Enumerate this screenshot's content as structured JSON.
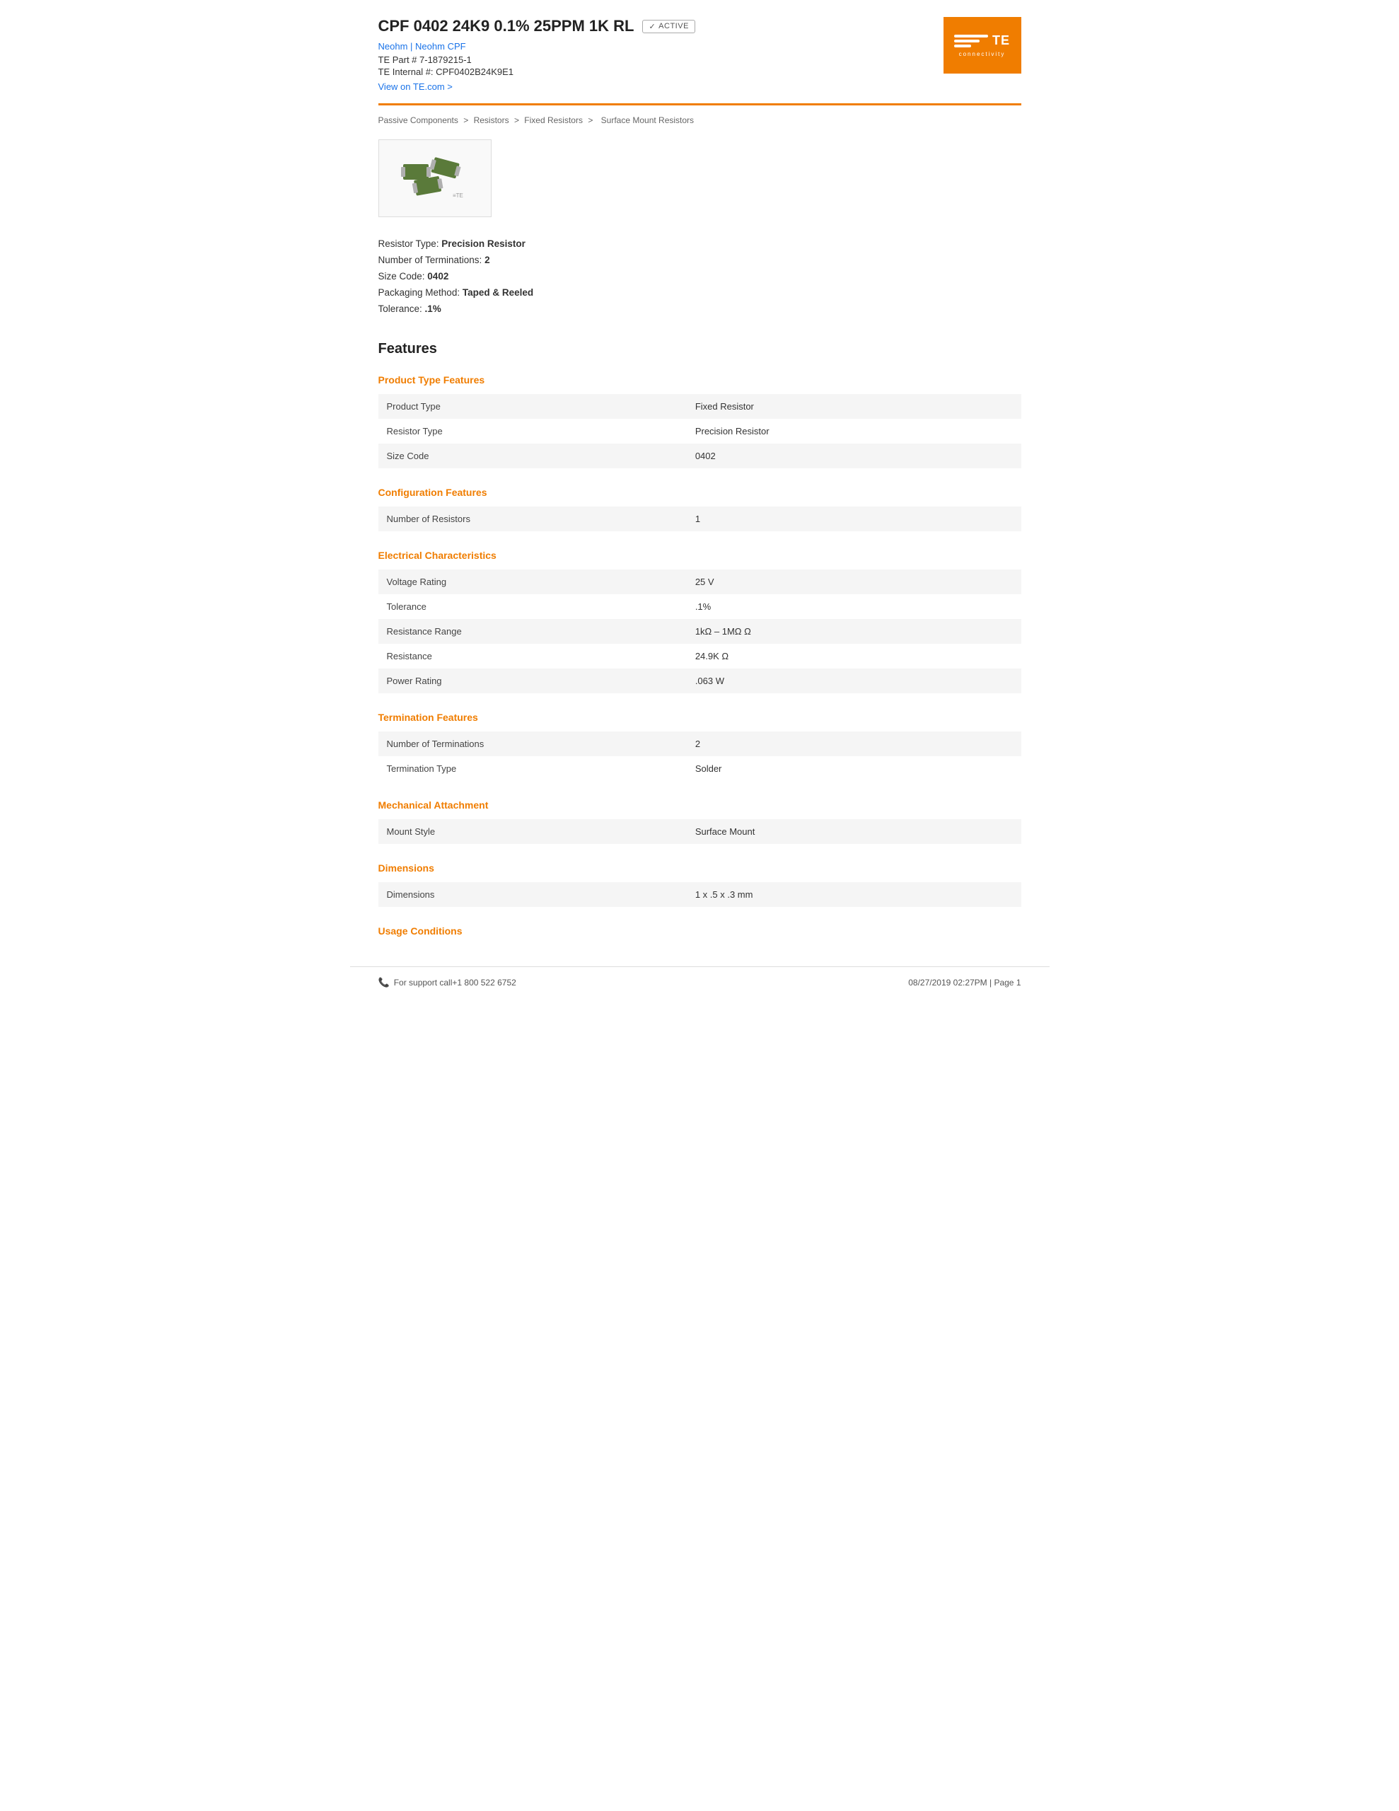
{
  "header": {
    "product_title": "CPF 0402 24K9 0.1% 25PPM 1K RL",
    "active_badge": "ACTIVE",
    "brand": "Neohm | Neohm CPF",
    "brand_link1": "Neohm",
    "brand_link2": "Neohm CPF",
    "te_part": "TE Part # 7-1879215-1",
    "te_internal": "TE Internal #: CPF0402B24K9E1",
    "view_link_text": "View on TE.com >",
    "view_link_href": "#"
  },
  "breadcrumb": {
    "items": [
      "Passive Components",
      "Resistors",
      "Fixed Resistors",
      "Surface Mount Resistors"
    ]
  },
  "quick_specs": [
    {
      "label": "Resistor Type:",
      "value": "Precision Resistor"
    },
    {
      "label": "Number of Terminations:",
      "value": "2"
    },
    {
      "label": "Size Code:",
      "value": "0402"
    },
    {
      "label": "Packaging Method:",
      "value": "Taped & Reeled"
    },
    {
      "label": "Tolerance:",
      "value": ".1%"
    }
  ],
  "features_heading": "Features",
  "sections": [
    {
      "title": "Product Type Features",
      "rows": [
        {
          "label": "Product Type",
          "value": "Fixed Resistor"
        },
        {
          "label": "Resistor Type",
          "value": "Precision Resistor"
        },
        {
          "label": "Size Code",
          "value": "0402"
        }
      ]
    },
    {
      "title": "Configuration Features",
      "rows": [
        {
          "label": "Number of Resistors",
          "value": "1"
        }
      ]
    },
    {
      "title": "Electrical Characteristics",
      "rows": [
        {
          "label": "Voltage Rating",
          "value": "25 V"
        },
        {
          "label": "Tolerance",
          "value": ".1%"
        },
        {
          "label": "Resistance Range",
          "value": "1kΩ – 1MΩ Ω"
        },
        {
          "label": "Resistance",
          "value": "24.9K Ω"
        },
        {
          "label": "Power Rating",
          "value": ".063 W"
        }
      ]
    },
    {
      "title": "Termination Features",
      "rows": [
        {
          "label": "Number of Terminations",
          "value": "2"
        },
        {
          "label": "Termination Type",
          "value": "Solder"
        }
      ]
    },
    {
      "title": "Mechanical Attachment",
      "rows": [
        {
          "label": "Mount Style",
          "value": "Surface Mount"
        }
      ]
    },
    {
      "title": "Dimensions",
      "rows": [
        {
          "label": "Dimensions",
          "value": "1 x .5 x .3 mm"
        }
      ]
    },
    {
      "title": "Usage Conditions",
      "rows": []
    }
  ],
  "footer": {
    "support_text": "For support call+1 800 522 6752",
    "date_page": "08/27/2019 02:27PM | Page 1"
  },
  "te_logo": {
    "text": "≡TE",
    "subtext": "connectivity"
  }
}
